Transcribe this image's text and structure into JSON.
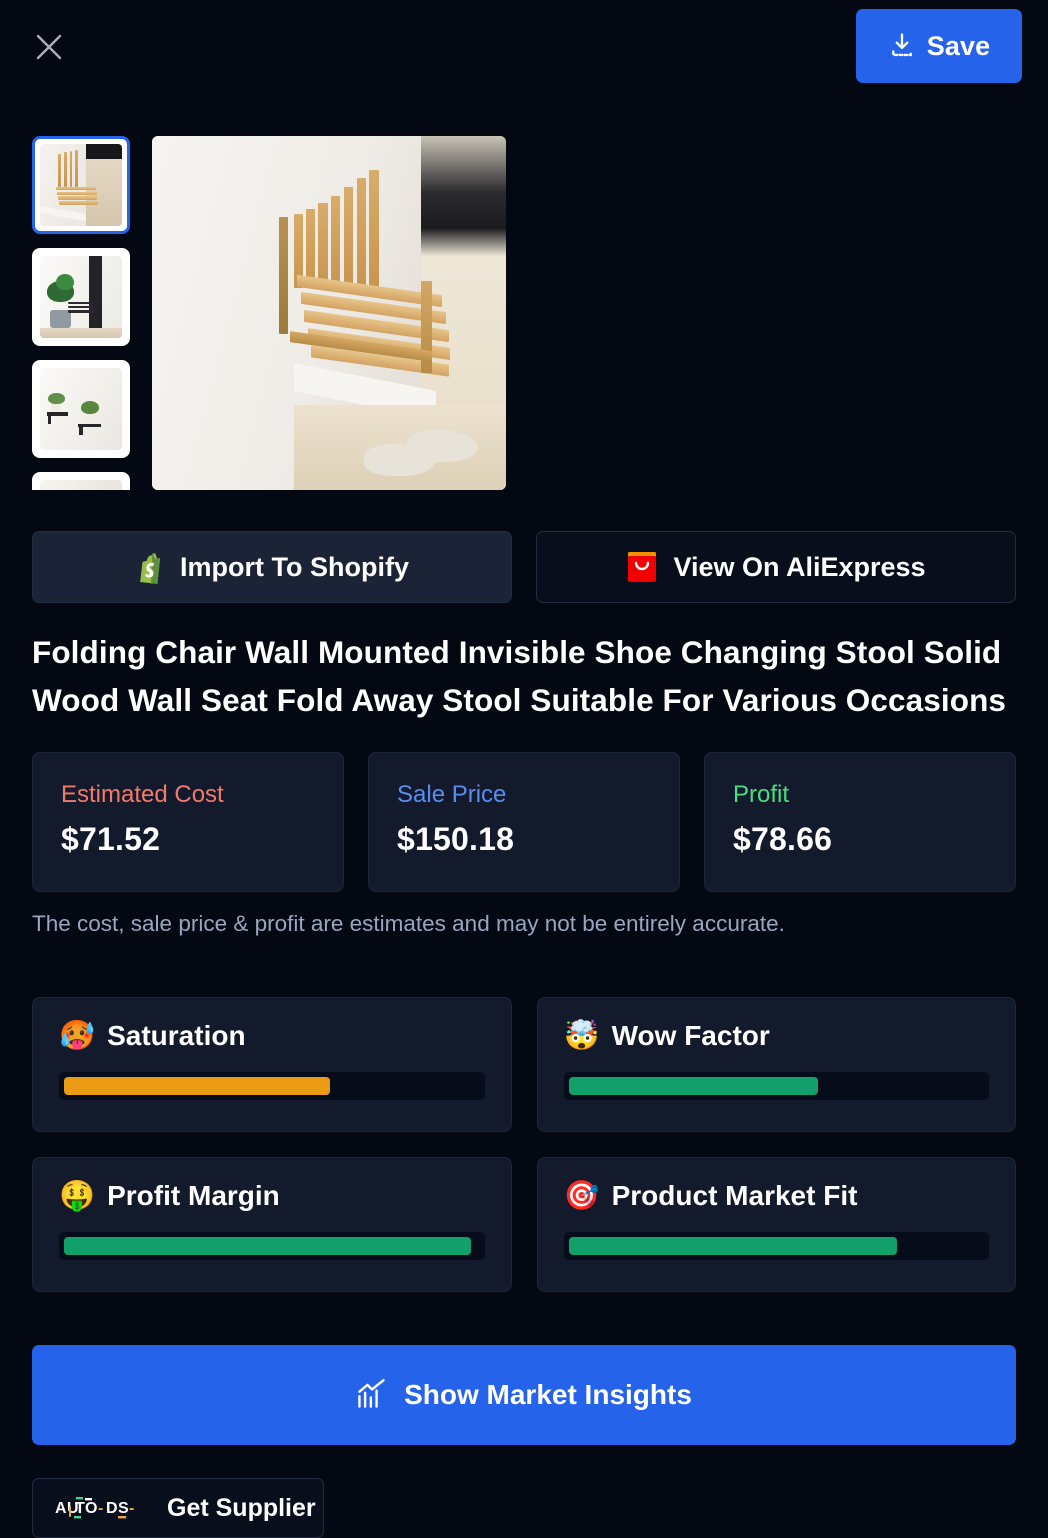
{
  "topbar": {
    "close_icon": "close-icon",
    "save_label": "Save",
    "save_icon": "download-icon",
    "save_color": "#2563eb"
  },
  "gallery": {
    "selected_index": 0,
    "selected_border_color": "#2563eb",
    "thumbnails": [
      {
        "alt": "Bamboo folding wall seat mounted on white wall"
      },
      {
        "alt": "Folded dark wall seat next to green plant"
      },
      {
        "alt": "Two small wall shelves with flower vases"
      },
      {
        "alt": "Close up of seat surface"
      }
    ],
    "hero": {
      "alt": "Bamboo folding chair wall mounted, unfolded, slippers on floor"
    }
  },
  "actions": [
    {
      "label": "Import To Shopify",
      "icon": "shopify-icon"
    },
    {
      "label": "View On AliExpress",
      "icon": "aliexpress-icon"
    }
  ],
  "product": {
    "title": "Folding Chair Wall Mounted Invisible Shoe Changing Stool Solid Wood Wall Seat Fold Away Stool Suitable For Various Occasions"
  },
  "prices": [
    {
      "label": "Estimated Cost",
      "value": "$71.52",
      "color": "#f4796b"
    },
    {
      "label": "Sale Price",
      "value": "$150.18",
      "color": "#5b8def"
    },
    {
      "label": "Profit",
      "value": "$78.66",
      "color": "#4ade80"
    }
  ],
  "disclaimer": "The cost, sale price & profit are estimates and may not be entirely accurate.",
  "metrics": [
    {
      "emoji": "🥵",
      "icon_name": "hot-face-emoji",
      "label": "Saturation",
      "percent": 64,
      "color": "#eb9a13"
    },
    {
      "emoji": "🤯",
      "icon_name": "exploding-head-emoji",
      "label": "Wow Factor",
      "percent": 60,
      "color": "#12a06a"
    },
    {
      "emoji": "🤑",
      "icon_name": "money-face-emoji",
      "label": "Profit Margin",
      "percent": 98,
      "color": "#12a06a"
    },
    {
      "emoji": "🎯",
      "icon_name": "dart-emoji",
      "label": "Product Market Fit",
      "percent": 79,
      "color": "#12a06a"
    }
  ],
  "bottom": {
    "insights_label": "Show Market Insights",
    "insights_icon": "chart-up-icon",
    "insights_color": "#2563eb",
    "supplier_label": "Get Supplier",
    "supplier_logo": {
      "part1": "AU",
      "part2": "T",
      "part3": "O",
      "dash1": "-",
      "part4": "D",
      "part5": "S",
      "dash2": "-"
    }
  }
}
